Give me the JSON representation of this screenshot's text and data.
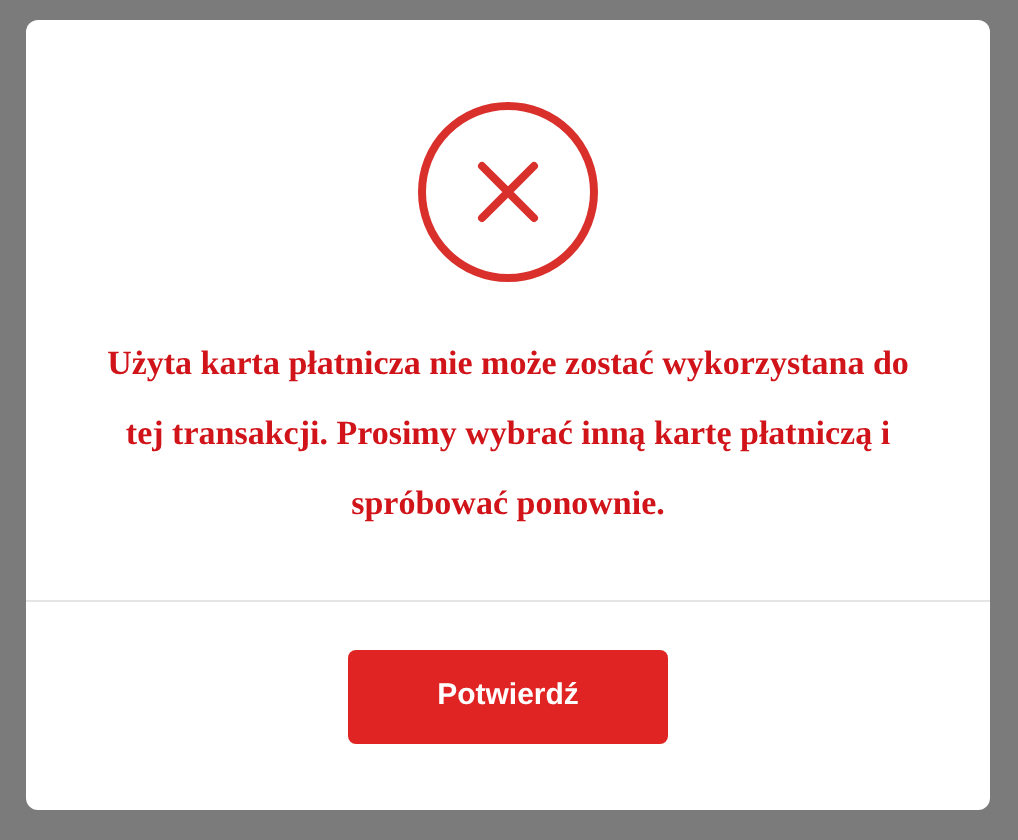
{
  "dialog": {
    "kind": "error",
    "message": "Użyta karta płatnicza nie może zostać wykorzystana do tej transakcji. Prosimy wybrać inną kartę płatniczą i spróbować ponownie.",
    "button": "Potwierdź"
  }
}
